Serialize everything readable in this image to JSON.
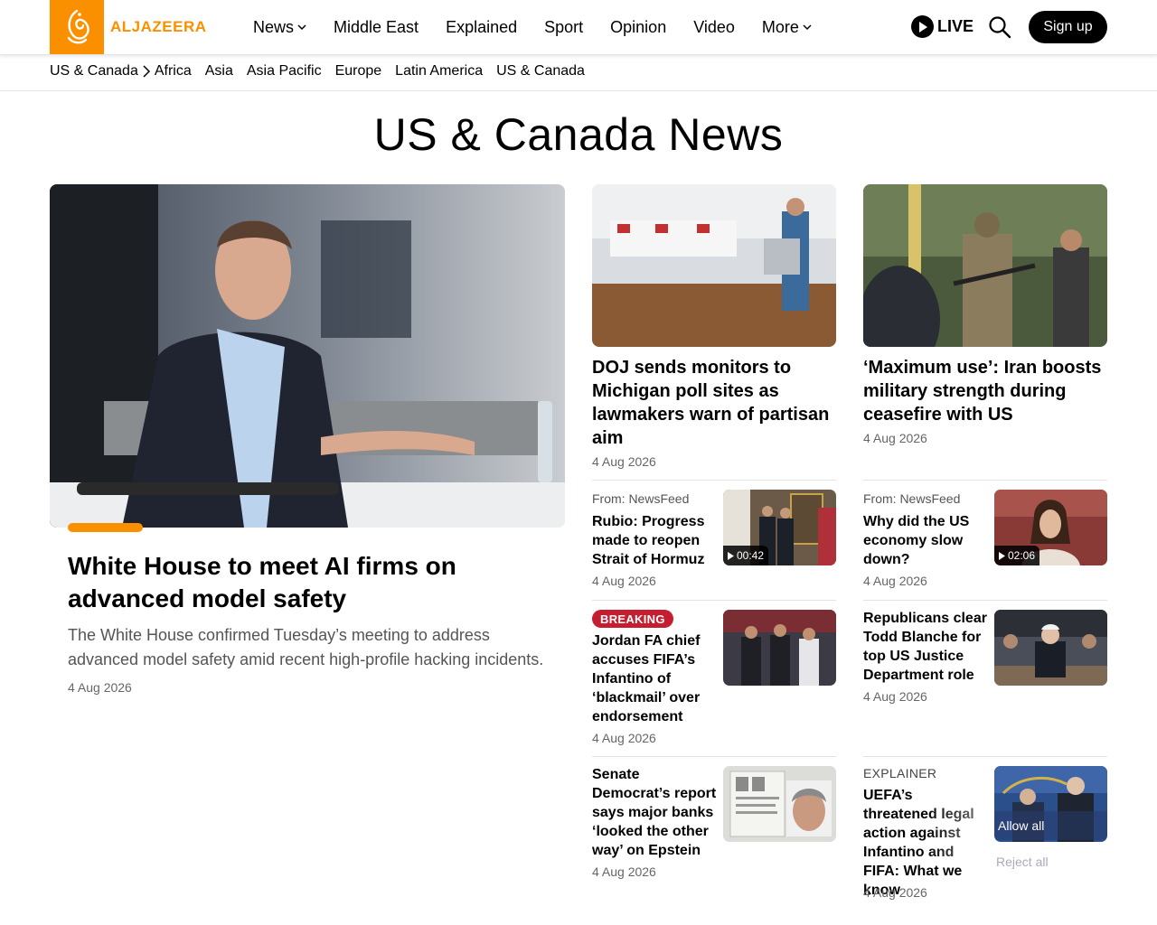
{
  "header": {
    "logo_text": "ALJAZEERA",
    "nav": [
      {
        "label": "News",
        "has_menu": true
      },
      {
        "label": "Middle East",
        "has_menu": false
      },
      {
        "label": "Explained",
        "has_menu": false
      },
      {
        "label": "Sport",
        "has_menu": false
      },
      {
        "label": "Opinion",
        "has_menu": false
      },
      {
        "label": "Video",
        "has_menu": false
      },
      {
        "label": "More",
        "has_menu": true
      }
    ],
    "live_label": "LIVE",
    "signup_label": "Sign up"
  },
  "subnav": {
    "current": "US & Canada",
    "items": [
      "Africa",
      "Asia",
      "Asia Pacific",
      "Europe",
      "Latin America",
      "US & Canada"
    ]
  },
  "page_title": "US & Canada News",
  "featured": {
    "title": "White House to meet AI firms on advanced model safety",
    "description": "The White House confirmed Tuesday’s meeting to address advanced model safety amid recent high-profile hacking incidents.",
    "date": "4 Aug 2026"
  },
  "top_cards": [
    {
      "title": "DOJ sends monitors to Michigan poll sites as lawmakers warn of partisan aim",
      "date": "4 Aug 2026"
    },
    {
      "title": "‘Maximum use’: Iran boosts military strength during ceasefire with US",
      "date": "4 Aug 2026"
    }
  ],
  "small_stories": [
    {
      "source": "From: NewsFeed",
      "title": "Rubio: Progress made to reopen Strait of Hormuz",
      "date": "4 Aug 2026",
      "duration": "00:42"
    },
    {
      "source": "From: NewsFeed",
      "title": "Why did the US economy slow down?",
      "date": "4 Aug 2026",
      "duration": "02:06"
    },
    {
      "badge": "BREAKING",
      "title": "Jordan FA chief accuses FIFA’s Infantino of ‘blackmail’ over endorsement",
      "date": "4 Aug 2026"
    },
    {
      "title": "Republicans clear Todd Blanche for top US Justice Department role",
      "date": "4 Aug 2026"
    },
    {
      "title": "Senate Democrat’s report says major banks ‘looked the other way’ on Epstein",
      "date": "4 Aug 2026"
    },
    {
      "badge": "EXPLAINER",
      "title": "UEFA’s threatened legal action against Infantino and FIFA: What we know",
      "date": "4 Aug 2026"
    }
  ],
  "consent": {
    "allow_label": "Allow all",
    "reject_label": "Reject all"
  },
  "colors": {
    "brand": "#fa9000",
    "breaking": "#c51e30"
  }
}
